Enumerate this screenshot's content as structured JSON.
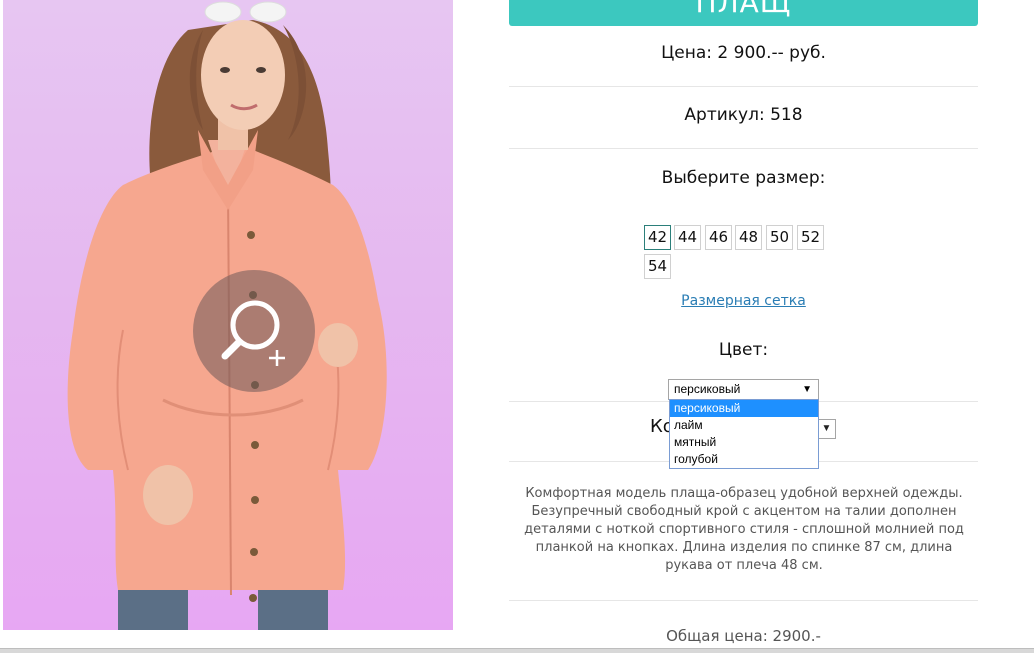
{
  "product": {
    "title": "ПЛАЩ",
    "price": "Цена: 2 900.-- руб.",
    "sku": "Артикул: 518",
    "size_label": "Выберите размер:",
    "sizes": [
      "42",
      "44",
      "46",
      "48",
      "50",
      "52",
      "54"
    ],
    "selected_size": "42",
    "size_chart_link": "Размерная сетка",
    "color_label": "Цвет:",
    "color_selected": "персиковый",
    "color_options": [
      "персиковый",
      "лайм",
      "мятный",
      "голубой"
    ],
    "quantity_label_partial": "Ко",
    "description": "Комфортная модель плаща-образец удобной верхней одежды. Безупречный свободный крой с акцентом на талии дополнен деталями с ноткой спортивного стиля - сплошной молнией под планкой на кнопках. Длина изделия по спинке 87 см, длина рукава от плеча 48 см.",
    "total": "Общая цена: 2900.-"
  },
  "colors": {
    "accent": "#3cc8bf",
    "link": "#2a7db4",
    "dropdown_highlight": "#1e90ff",
    "coat": "#f6a78f"
  },
  "icons": {
    "zoom": "magnifier-plus-icon",
    "select_arrow": "▼"
  }
}
